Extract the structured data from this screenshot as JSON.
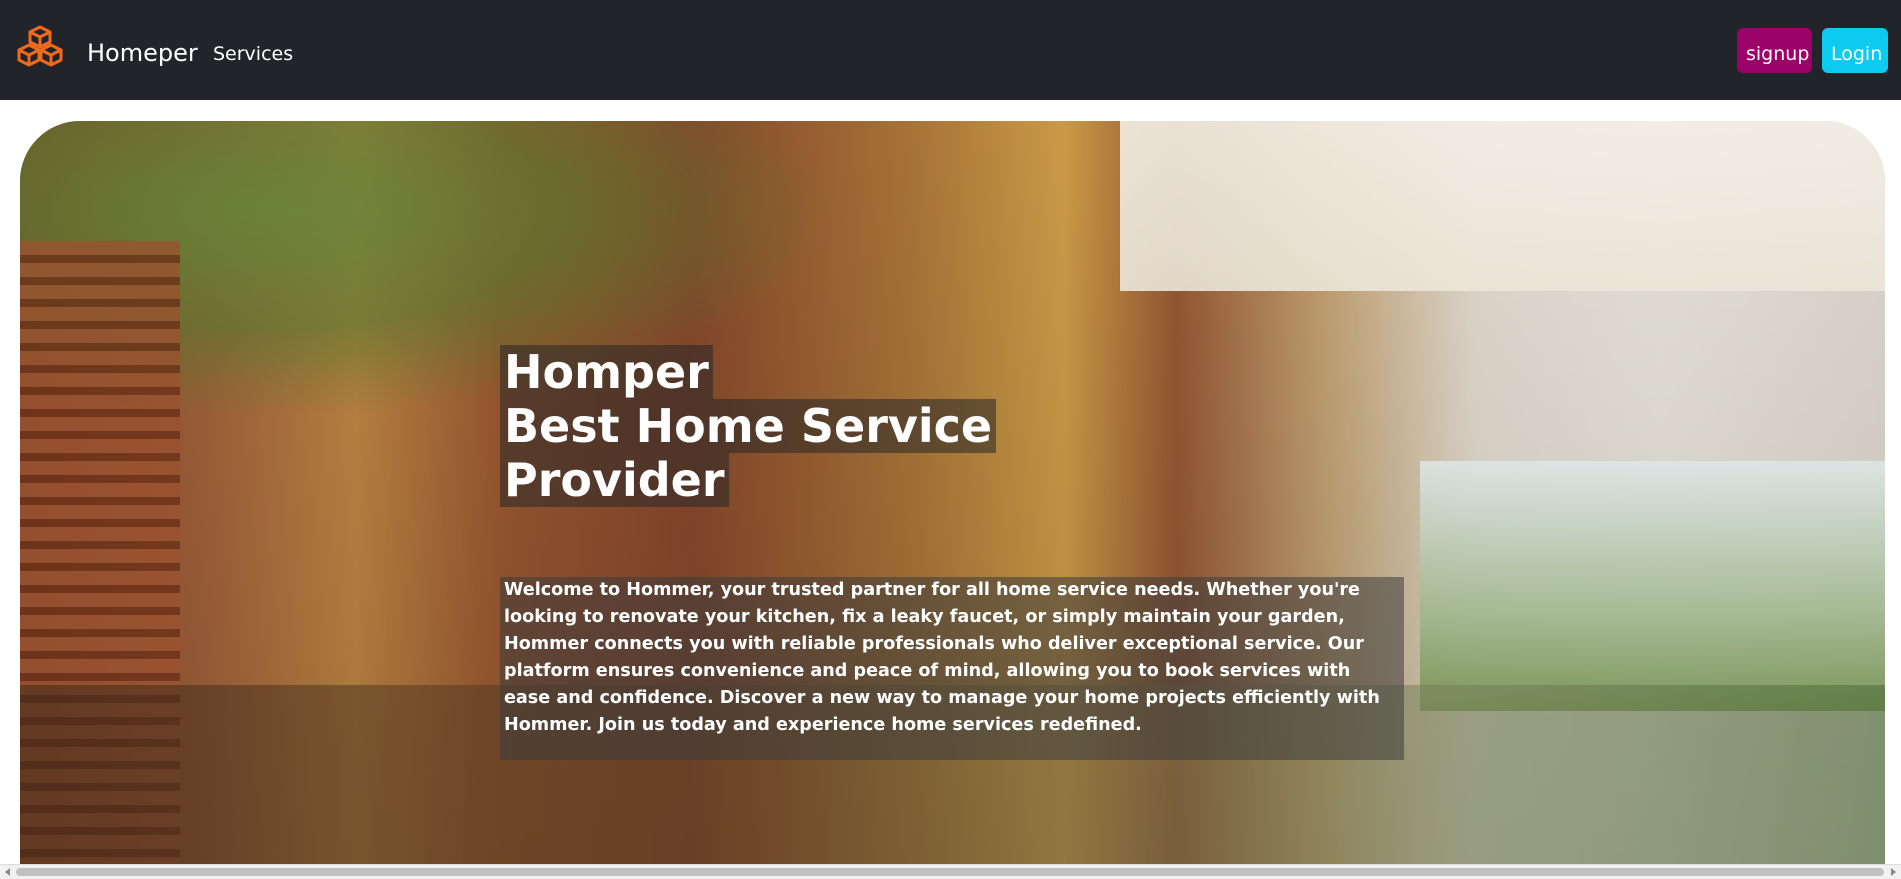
{
  "navbar": {
    "brand": "Homeper",
    "logo_icon": "boxes-icon",
    "logo_color": "#f26a1b",
    "background_color": "#212529",
    "links": [
      {
        "label": "Services"
      }
    ],
    "signup_label": "signup",
    "login_label": "Login",
    "signup_color": "#9c0069",
    "login_color": "#0dcaf0"
  },
  "hero": {
    "title_lines": [
      "Homper",
      "Best Home Service",
      "Provider"
    ],
    "description": "Welcome to Hommer, your trusted partner for all home service needs. Whether you're looking to renovate your kitchen, fix a leaky faucet, or simply maintain your garden, Hommer connects you with reliable professionals who deliver exceptional service. Our platform ensures convenience and peace of mind, allowing you to book services with ease and confidence. Discover a new way to manage your home projects efficiently with Hommer. Join us today and experience home services redefined."
  }
}
